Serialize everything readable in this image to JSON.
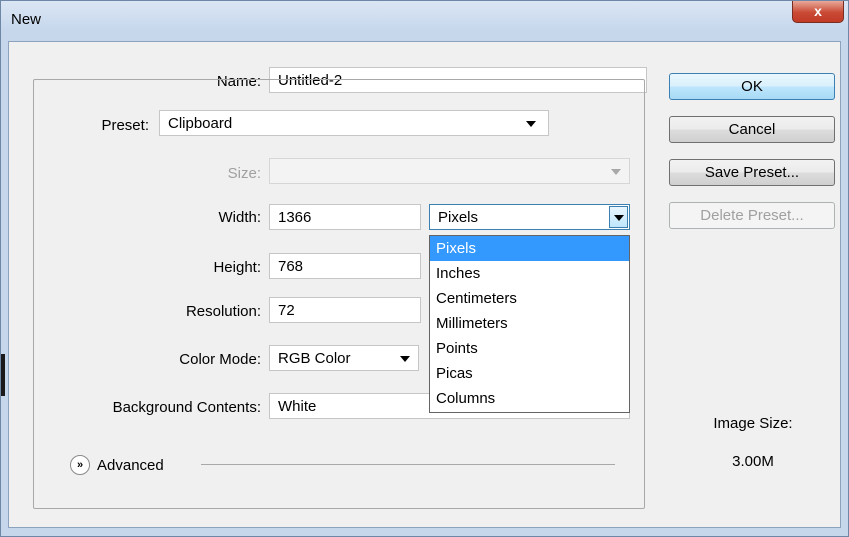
{
  "window": {
    "title": "New",
    "close_label": "x"
  },
  "form": {
    "name_label": "Name:",
    "name_value": "Untitled-2",
    "preset_label": "Preset:",
    "preset_value": "Clipboard",
    "size_label": "Size:",
    "size_value": "",
    "width_label": "Width:",
    "width_value": "1366",
    "width_unit": "Pixels",
    "height_label": "Height:",
    "height_value": "768",
    "resolution_label": "Resolution:",
    "resolution_value": "72",
    "color_mode_label": "Color Mode:",
    "color_mode_value": "RGB Color",
    "background_label": "Background Contents:",
    "background_value": "White",
    "advanced_label": "Advanced"
  },
  "unit_options": [
    "Pixels",
    "Inches",
    "Centimeters",
    "Millimeters",
    "Points",
    "Picas",
    "Columns"
  ],
  "unit_selected": "Pixels",
  "buttons": {
    "ok": "OK",
    "cancel": "Cancel",
    "save_preset": "Save Preset...",
    "delete_preset": "Delete Preset..."
  },
  "image_size": {
    "label": "Image Size:",
    "value": "3.00M"
  },
  "icons": {
    "close": "close-icon",
    "advanced": "expand-chevrons-icon",
    "dropdown": "chevron-down-icon"
  },
  "colors": {
    "selection": "#3399ff",
    "titlebar": "#c6d7ec",
    "close": "#c94a35"
  }
}
